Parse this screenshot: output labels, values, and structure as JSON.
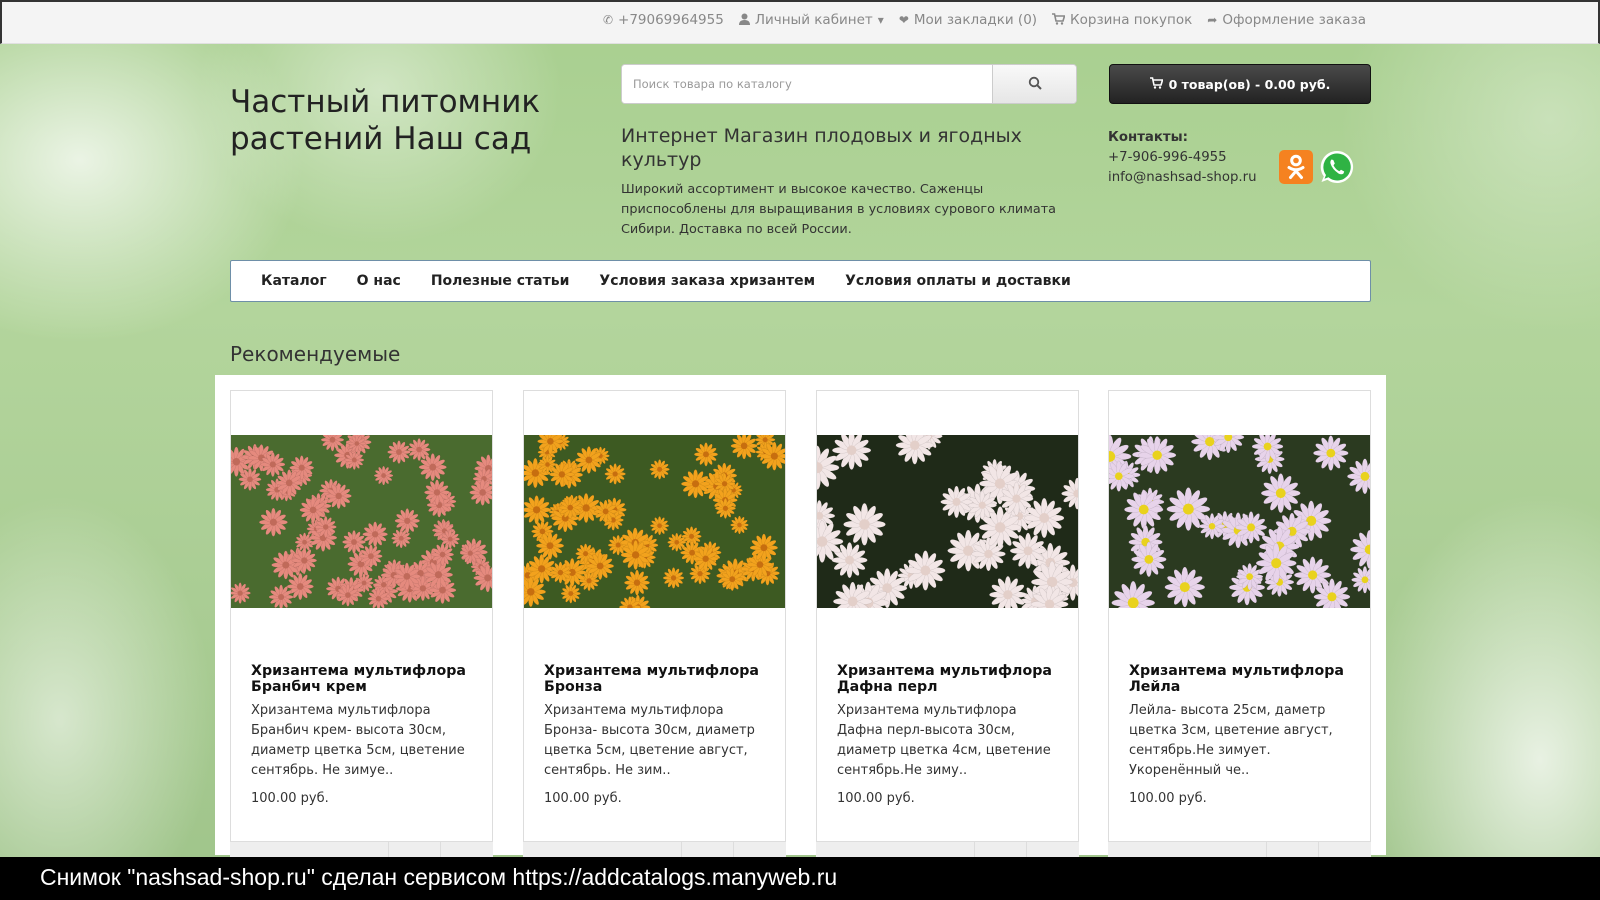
{
  "topnav": {
    "phone": "+79069964955",
    "account": "Личный кабинет",
    "bookmarks": "Мои закладки (0)",
    "cart": "Корзина покупок",
    "checkout": "Оформление заказа"
  },
  "header": {
    "logo": "Частный питомник растений Наш сад",
    "tagline": "Интернет Магазин плодовых и ягодных культур",
    "description": "Широкий ассортимент и высокое качество. Саженцы приспособлены для выращивания в условиях сурового климата Сибири. Доставка по всей России."
  },
  "search": {
    "placeholder": "Поиск товара по каталогу",
    "value": ""
  },
  "cart_button": {
    "label": "0 товар(ов) - 0.00 руб."
  },
  "contacts": {
    "title": "Контакты:",
    "phone": "+7-906-996-4955",
    "email": "info@nashsad-shop.ru"
  },
  "social": {
    "ok_icon": "odnoklassniki-icon",
    "wa_icon": "whatsapp-icon",
    "ok_color": "#f58220",
    "wa_color": "#2fb344"
  },
  "mainnav": {
    "items": [
      {
        "label": "Каталог"
      },
      {
        "label": "О нас"
      },
      {
        "label": "Полезные статьи"
      },
      {
        "label": "Условия заказа хризантем"
      },
      {
        "label": "Условия оплаты и доставки"
      }
    ]
  },
  "section": {
    "title": "Рекомендуемые"
  },
  "products": [
    {
      "name": "Хризантема мультифлора Бранбич крем",
      "description": "Хризантема мультифлора Бранбич крем- высота 30см, диаметр цветка 5см, цветение сентябрь. Не зимуе..",
      "price": "100.00 руб.",
      "petal": "#e58a7e",
      "center": "#c06a5a",
      "leaf": "#4a6b2f"
    },
    {
      "name": "Хризантема мультифлора Бронза",
      "description": "Хризантема мультифлора Бронза- высота 30см, диаметр цветка 5см, цветение август, сентябрь. Не зим..",
      "price": "100.00 руб.",
      "petal": "#f2a21d",
      "center": "#c76e0f",
      "leaf": "#3d5a22"
    },
    {
      "name": "Хризантема мультифлора Дафна перл",
      "description": " Хризантема мультифлора Дафна перл-высота 30см, диаметр цветка 4см, цветение сентябрь.Не зиму..",
      "price": "100.00 руб.",
      "petal": "#f2e6e6",
      "center": "#e3cfc9",
      "leaf": "#1f2a18"
    },
    {
      "name": "Хризантема мультифлора Лейла",
      "description": "Лейла- высота 25см, даметр цветка 3см, цветение август, сентябрь.Не зимует. Укоренённый че..",
      "price": "100.00 руб.",
      "petal": "#e7d3ea",
      "center": "#e9d21d",
      "leaf": "#2b3a20"
    }
  ],
  "capture_bar": {
    "text": "Снимок \"nashsad-shop.ru\" сделан сервисом https://addcatalogs.manyweb.ru"
  }
}
